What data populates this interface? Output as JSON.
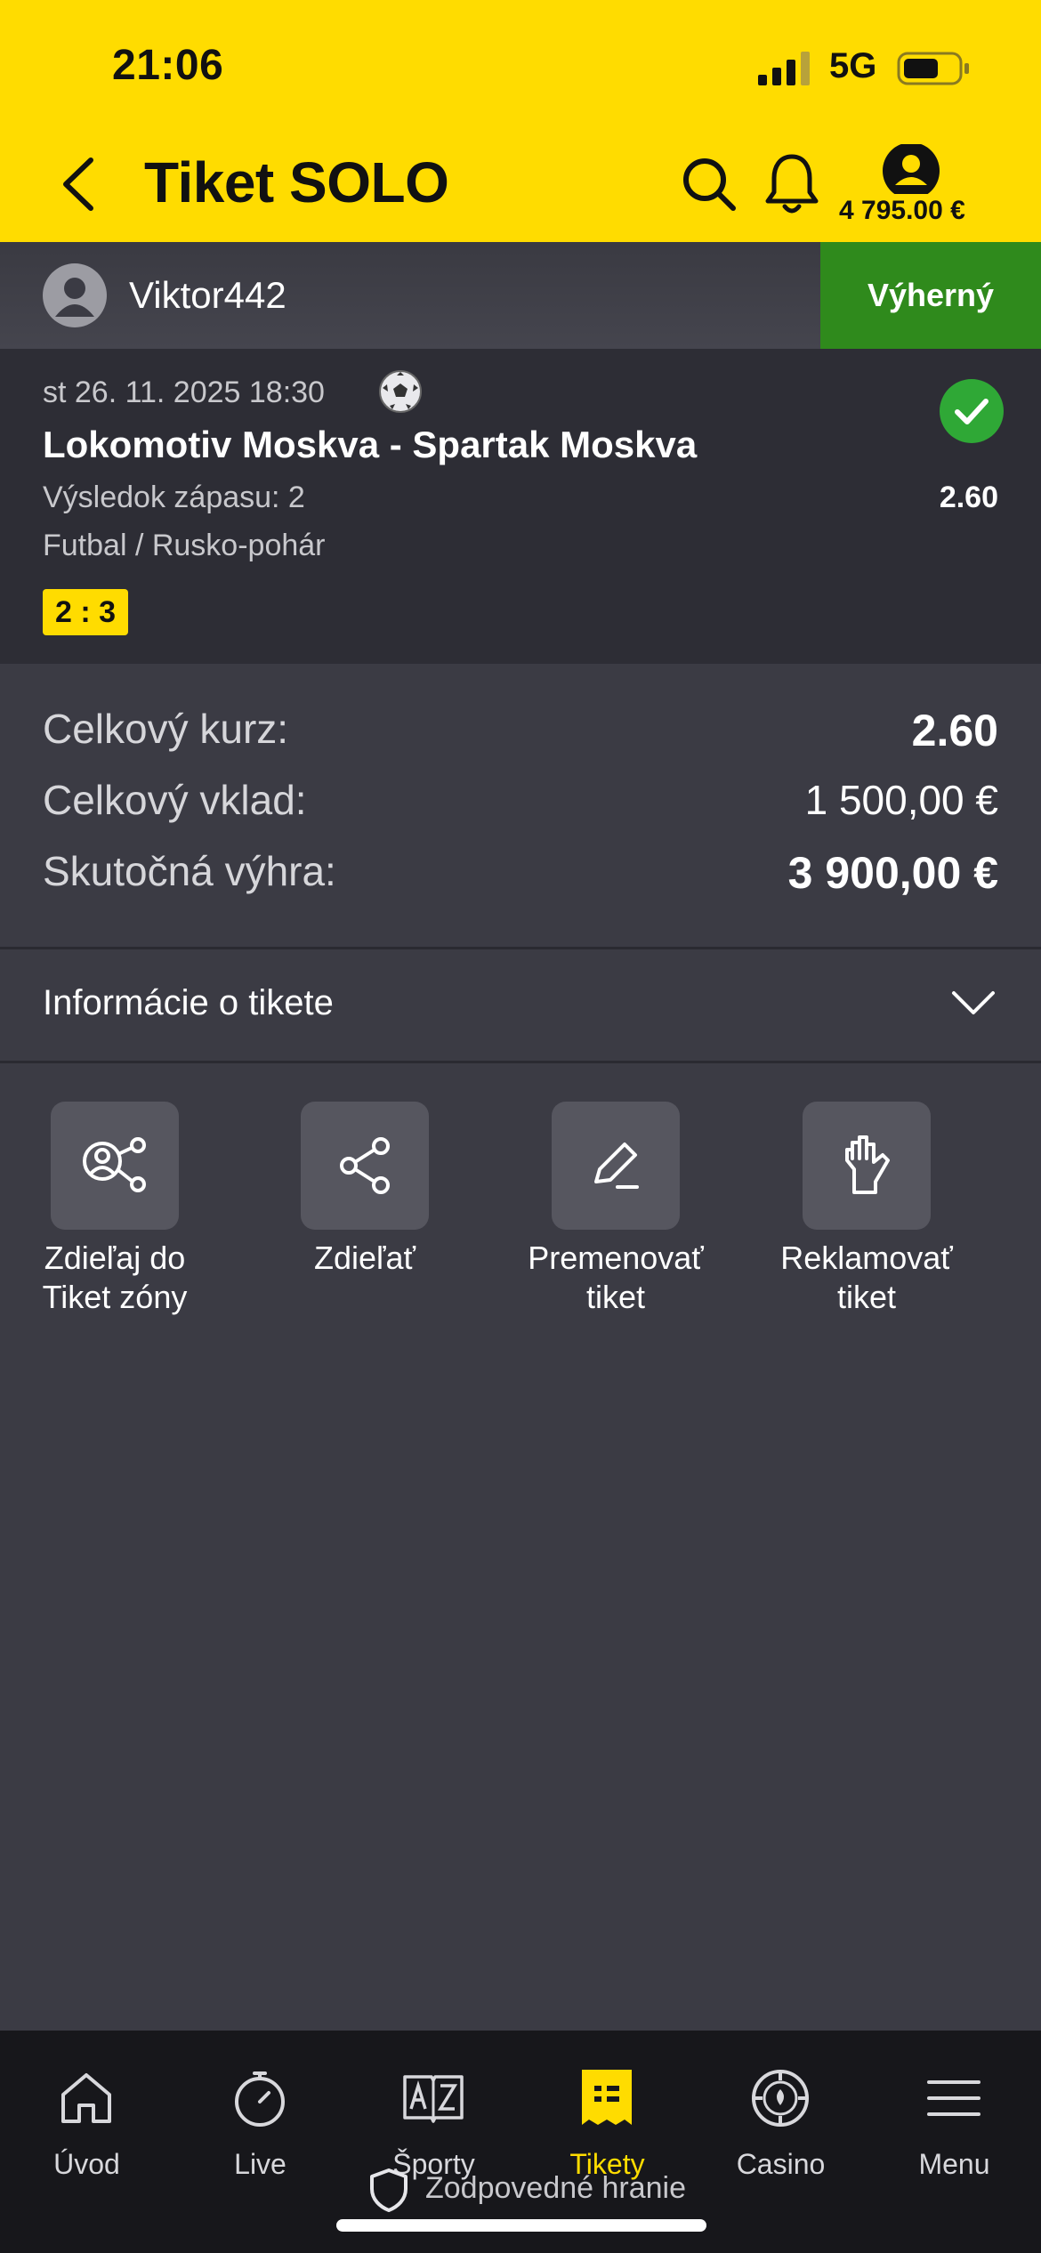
{
  "status_bar": {
    "time": "21:06",
    "network": "5G"
  },
  "header": {
    "title": "Tiket SOLO",
    "balance": "4 795.00 €"
  },
  "user": {
    "name": "Viktor442",
    "result": "Výherný"
  },
  "match": {
    "datetime": "st 26. 11. 2025 18:30",
    "teams": "Lokomotiv Moskva - Spartak Moskva",
    "market": "Výsledok zápasu: 2",
    "odds": "2.60",
    "league": "Futbal / Rusko-pohár",
    "score": "2 : 3"
  },
  "summary": {
    "total_odds_label": "Celkový kurz:",
    "total_odds_value": "2.60",
    "total_stake_label": "Celkový vklad:",
    "total_stake_value": "1 500,00 €",
    "actual_win_label": "Skutočná výhra:",
    "actual_win_value": "3 900,00 €"
  },
  "info": {
    "label": "Informácie o tikete"
  },
  "actions": [
    {
      "label": "Zdieľaj do\nTiket zóny",
      "icon": "share-to-zone-icon"
    },
    {
      "label": "Zdieľať",
      "icon": "share-icon"
    },
    {
      "label": "Premenovať\ntiket",
      "icon": "pencil-icon"
    },
    {
      "label": "Reklamovať\ntiket",
      "icon": "hand-icon"
    }
  ],
  "bottom_nav": [
    {
      "label": "Úvod",
      "icon": "home-icon"
    },
    {
      "label": "Live",
      "icon": "stopwatch-icon"
    },
    {
      "label": "Športy",
      "icon": "az-book-icon"
    },
    {
      "label": "Tikety",
      "icon": "ticket-icon",
      "active": true
    },
    {
      "label": "Casino",
      "icon": "casino-chip-icon"
    },
    {
      "label": "Menu",
      "icon": "hamburger-icon"
    }
  ],
  "responsible_gaming": "Zodpovedné hranie",
  "colors": {
    "brand_yellow": "#ffdc00",
    "win_green": "#2f8a1c",
    "background": "#3b3b44"
  }
}
